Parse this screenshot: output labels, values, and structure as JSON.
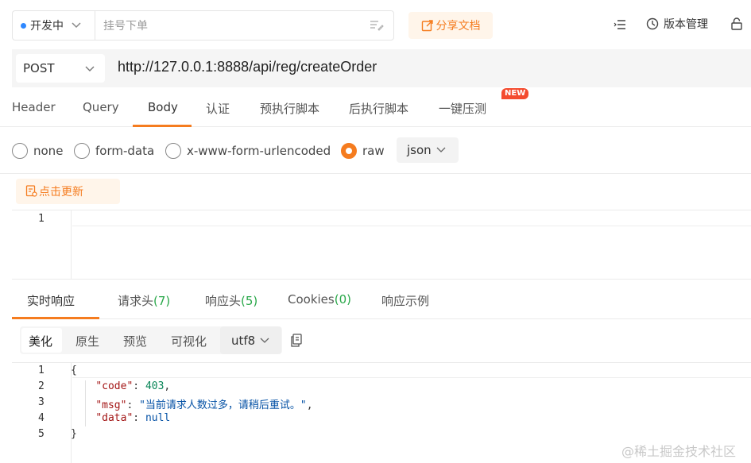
{
  "topbar": {
    "status_label": "开发中",
    "name_placeholder": "挂号下单",
    "share_label": "分享文档",
    "version_label": "版本管理"
  },
  "request": {
    "method": "POST",
    "url": "http://127.0.0.1:8888/api/reg/createOrder"
  },
  "request_tabs": [
    {
      "label": "Header"
    },
    {
      "label": "Query"
    },
    {
      "label": "Body"
    },
    {
      "label": "认证"
    },
    {
      "label": "预执行脚本"
    },
    {
      "label": "后执行脚本"
    },
    {
      "label": "一键压测"
    }
  ],
  "new_badge": "NEW",
  "body_types": [
    {
      "label": "none",
      "checked": false
    },
    {
      "label": "form-data",
      "checked": false
    },
    {
      "label": "x-www-form-urlencoded",
      "checked": false
    },
    {
      "label": "raw",
      "checked": true
    }
  ],
  "format": "json",
  "refresh_label": "点击更新",
  "request_editor": {
    "line_numbers": [
      "1"
    ]
  },
  "response_tabs": [
    {
      "label": "实时响应",
      "count": ""
    },
    {
      "label": "请求头",
      "count": "(7)"
    },
    {
      "label": "响应头",
      "count": "(5)"
    },
    {
      "label": "Cookies",
      "count": "(0)"
    },
    {
      "label": "响应示例",
      "count": ""
    }
  ],
  "view_modes": [
    "美化",
    "原生",
    "预览",
    "可视化"
  ],
  "encoding": "utf8",
  "response": {
    "line_numbers": [
      "1",
      "2",
      "3",
      "4",
      "5"
    ],
    "open_brace": "{",
    "close_brace": "}",
    "code_key": "\"code\"",
    "code_val": "403",
    "msg_key": "\"msg\"",
    "msg_val": "\"当前请求人数过多，请稍后重试。\"",
    "data_key": "\"data\"",
    "data_val": "null"
  },
  "watermark": "@稀土掘金技术社区",
  "colors": {
    "accent": "#f57c1f",
    "count_green": "#2aa84a",
    "badge_red": "#f44b2e"
  }
}
